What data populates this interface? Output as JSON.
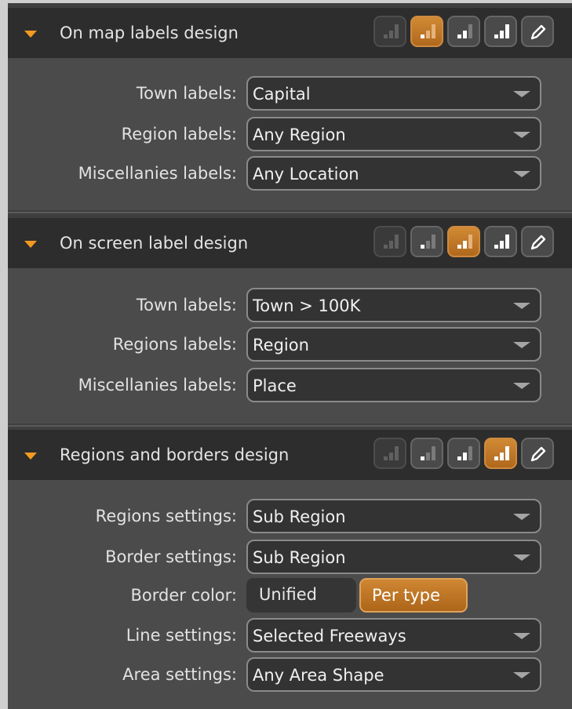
{
  "panels": [
    {
      "title": "On map labels design",
      "active_level": 2,
      "rows": [
        {
          "label": "Town labels:",
          "value": "Capital"
        },
        {
          "label": "Region labels:",
          "value": "Any Region"
        },
        {
          "label": "Miscellanies labels:",
          "value": "Any Location"
        }
      ]
    },
    {
      "title": "On screen label design",
      "active_level": 3,
      "rows": [
        {
          "label": "Town labels:",
          "value": "Town > 100K"
        },
        {
          "label": "Regions labels:",
          "value": "Region"
        },
        {
          "label": "Miscellanies labels:",
          "value": "Place"
        }
      ]
    },
    {
      "title": "Regions and borders design",
      "active_level": 4,
      "rows": [
        {
          "label": "Regions settings:",
          "value": "Sub Region"
        },
        {
          "label": "Border settings:",
          "value": "Sub Region"
        },
        {
          "label": "Border color:",
          "options": [
            "Unified",
            "Per type"
          ],
          "selected": "Per type"
        },
        {
          "label": "Line settings:",
          "value": "Selected Freeways"
        },
        {
          "label": "Area settings:",
          "value": "Any Area Shape"
        }
      ]
    }
  ],
  "icons": {
    "collapse": "triangle-down-icon",
    "level": "signal-bars-icon",
    "edit": "pencil-icon"
  },
  "colors": {
    "accent": "#f39a21",
    "active_button": "#c27a2a",
    "header_bg": "#2d2d2d",
    "panel_bg": "#4b4b4b"
  }
}
